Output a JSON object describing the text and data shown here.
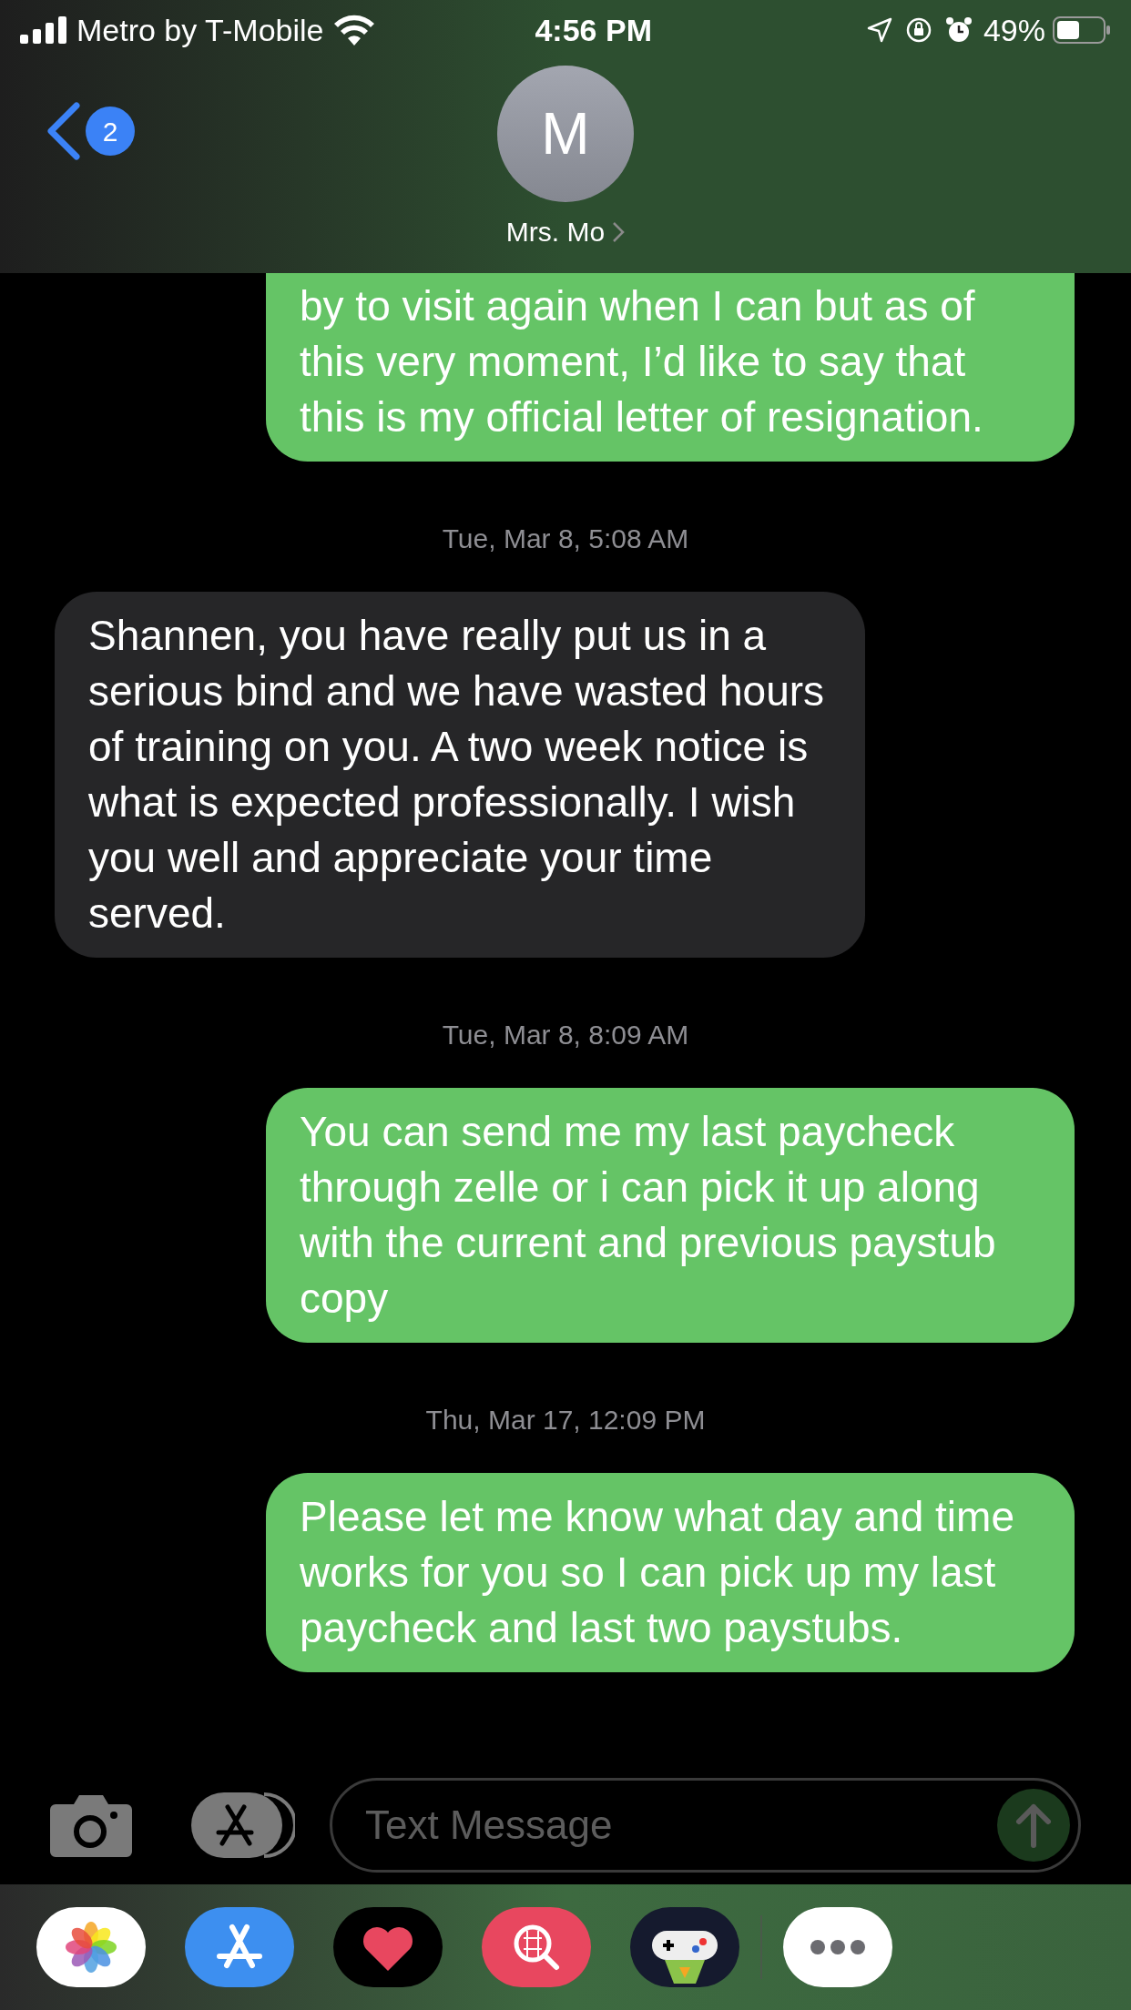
{
  "status_bar": {
    "carrier": "Metro by T-Mobile",
    "time": "4:56 PM",
    "battery": "49%"
  },
  "header": {
    "back_badge": "2",
    "avatar_initial": "M",
    "contact_name": "Mrs. Mo"
  },
  "messages": [
    {
      "kind": "sent",
      "text": "by to visit again when I can but as of this very moment, I’d like to say that this is my official letter of resignation."
    },
    {
      "kind": "timestamp",
      "text": "Tue, Mar 8, 5:08 AM"
    },
    {
      "kind": "received",
      "text": "Shannen, you have really put us in a serious bind and we have wasted hours of training on you. A two week notice is what is expected professionally. I wish you well and appreciate your time served."
    },
    {
      "kind": "timestamp",
      "text": "Tue, Mar 8, 8:09 AM"
    },
    {
      "kind": "sent",
      "text": "You can send me my last paycheck through zelle or i can pick it up along with the current and previous paystub copy"
    },
    {
      "kind": "timestamp",
      "text": "Thu, Mar 17, 12:09 PM"
    },
    {
      "kind": "sent",
      "text": "Please let me know what day and time works for you so I can pick up my last paycheck and last two paystubs."
    }
  ],
  "composer": {
    "placeholder": "Text Message"
  }
}
